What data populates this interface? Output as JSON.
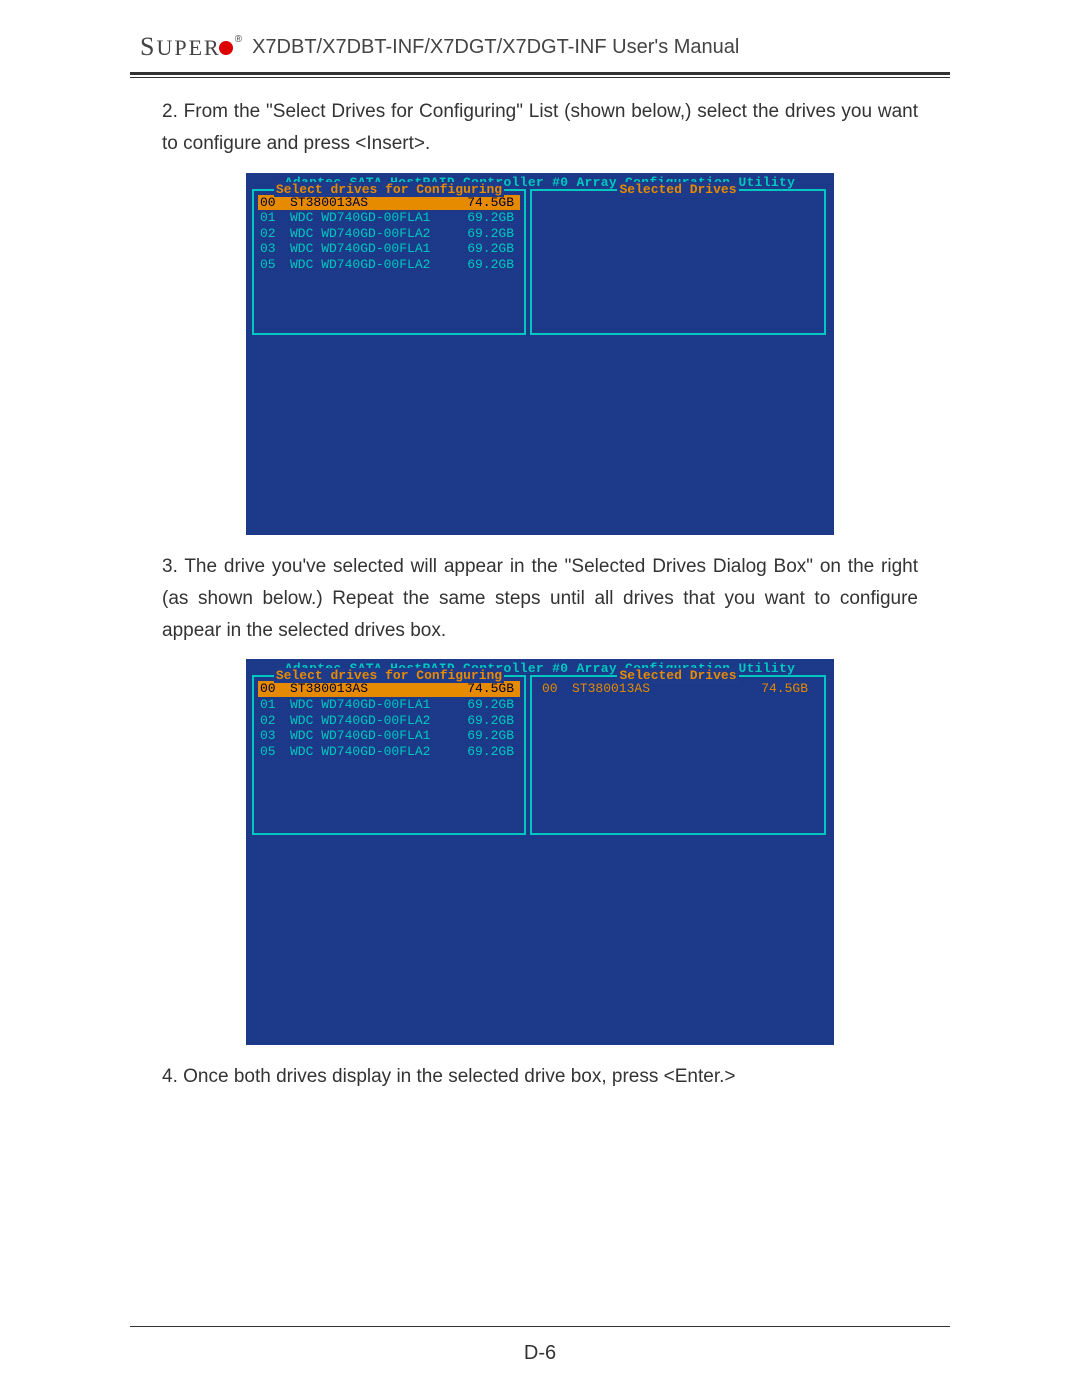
{
  "header": {
    "logo_text": "SUPER",
    "title": "X7DBT/X7DBT-INF/X7DGT/X7DGT-INF User's Manual"
  },
  "para2": "2. From the \"Select Drives for Configuring\" List (shown below,) select the drives you want to configure and press <Insert>.",
  "para3": "3. The drive you've selected will appear in the \"Selected Drives Dialog Box\" on the right (as shown below.) Repeat the same steps until all drives that you want to configure appear in the selected drives box.",
  "para4": "4. Once both drives display in the selected drive box, press <Enter.>",
  "page_num": "D-6",
  "bios": {
    "title": "Adaptec SATA HostRAID Controller #0 Array Configuration Utility",
    "left_panel_title": "Select drives for Configuring",
    "right_panel_title": "Selected Drives",
    "drives": [
      {
        "id": "00",
        "model": "ST380013AS",
        "size": "74.5GB",
        "hl": true
      },
      {
        "id": "01",
        "model": "WDC WD740GD-00FLA1",
        "size": "69.2GB",
        "hl": false
      },
      {
        "id": "02",
        "model": "WDC WD740GD-00FLA2",
        "size": "69.2GB",
        "hl": false
      },
      {
        "id": "03",
        "model": "WDC WD740GD-00FLA1",
        "size": "69.2GB",
        "hl": false
      },
      {
        "id": "05",
        "model": "WDC WD740GD-00FLA2",
        "size": "69.2GB",
        "hl": false
      }
    ],
    "selected_drives": [
      {
        "id": "00",
        "model": "ST380013AS",
        "size": "74.5GB"
      }
    ]
  }
}
